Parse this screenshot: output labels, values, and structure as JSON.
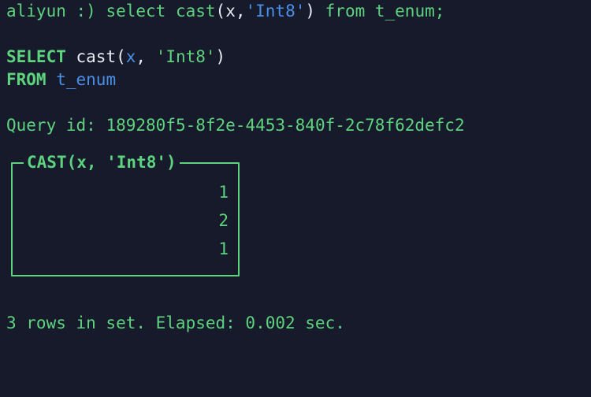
{
  "terminal": {
    "background_color": "#161a2b",
    "green": "#5ed37e",
    "blue": "#4a90e8",
    "white": "#e9ecf2"
  },
  "prompt_line": {
    "host": "aliyun",
    "prompt_symbol": " :) ",
    "command_keyword_select": "select",
    "command_space": " ",
    "command_func": "cast",
    "paren_open": "(",
    "arg_x": "x",
    "comma": ",",
    "type_literal": "'Int8'",
    "paren_close": ")",
    "from_clause": " from t_enum;"
  },
  "formatted_query": {
    "select_keyword": "SELECT",
    "select_space": " ",
    "cast_func": "cast(",
    "cast_arg": "x",
    "cast_comma": ", ",
    "cast_type": "'Int8'",
    "cast_close": ")",
    "from_keyword": "FROM",
    "from_space": " ",
    "from_table": "t_enum"
  },
  "query_info": {
    "label": "Query id: ",
    "id": "189280f5-8f2e-4453-840f-2c78f62defc2"
  },
  "result": {
    "column_header": "CAST(x, 'Int8')",
    "values": [
      "1",
      "2",
      "1"
    ]
  },
  "status": {
    "text": "3 rows in set. Elapsed: 0.002 sec."
  }
}
